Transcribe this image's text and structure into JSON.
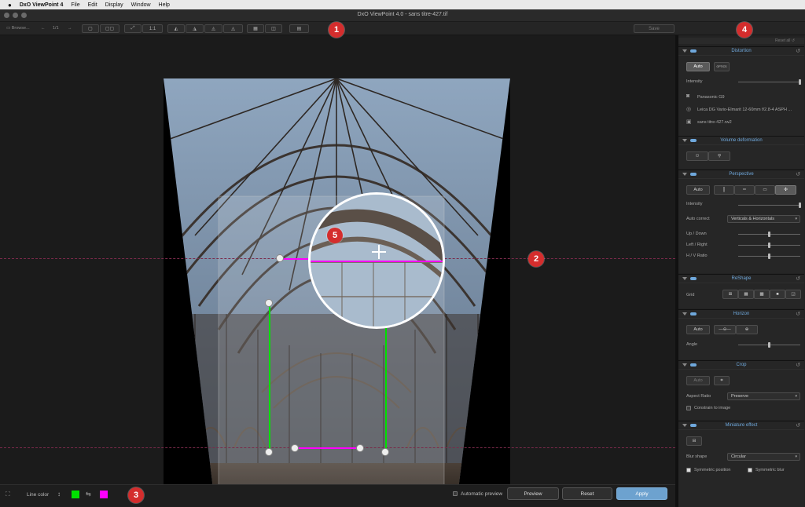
{
  "menubar": {
    "apple": "",
    "app_name": "DxO ViewPoint 4",
    "items": [
      "File",
      "Edit",
      "Display",
      "Window",
      "Help"
    ]
  },
  "window": {
    "title": "DxO ViewPoint 4.0 - sans titre-427.tif"
  },
  "toolbar": {
    "browse_label": "Browse...",
    "page_counter": "1/1",
    "zoom_one_to_one": "1:1",
    "save_label": "Save"
  },
  "callouts": [
    "1",
    "2",
    "3",
    "4",
    "5"
  ],
  "bottombar": {
    "line_color_label": "Line color",
    "automatic_preview_label": "Automatic preview",
    "preview_label": "Preview",
    "reset_label": "Reset",
    "apply_label": "Apply",
    "colors": {
      "vertical_line": "#00e000",
      "horizontal_line": "#ff00ff"
    }
  },
  "panel": {
    "reset_all": "Reset all",
    "distortion": {
      "title": "Distortion",
      "auto_label": "Auto",
      "lens_icon_label": "OPTICS",
      "intensity_label": "Intensity",
      "intensity_value": 1.0,
      "camera": "Panasonic G9",
      "lens": "Leica DG Vario-Elmarit 12-60mm f/2.8-4 ASPH ...",
      "file": "sans titre-427.rw2"
    },
    "volume": {
      "title": "Volume deformation"
    },
    "perspective": {
      "title": "Perspective",
      "auto_label": "Auto",
      "intensity_label": "Intensity",
      "intensity_value": 1.0,
      "auto_correct_label": "Auto correct",
      "auto_correct_value": "Verticals & Horizontals",
      "up_down_label": "Up / Down",
      "left_right_label": "Left / Right",
      "hv_ratio_label": "H / V Ratio",
      "up_down_value": 0.5,
      "left_right_value": 0.5,
      "hv_ratio_value": 0.5
    },
    "reshape": {
      "title": "ReShape",
      "grid_label": "Grid"
    },
    "horizon": {
      "title": "Horizon",
      "auto_label": "Auto",
      "angle_label": "Angle",
      "angle_value": 0.5
    },
    "crop": {
      "title": "Crop",
      "auto_label": "Auto",
      "aspect_ratio_label": "Aspect Ratio",
      "aspect_ratio_value": "Preserve",
      "constrain_label": "Constrain to image"
    },
    "miniature": {
      "title": "Miniature effect",
      "blur_shape_label": "Blur shape",
      "blur_shape_value": "Circular",
      "symmetric_position_label": "Symmetric position",
      "symmetric_blur_label": "Symmetric blur"
    }
  }
}
